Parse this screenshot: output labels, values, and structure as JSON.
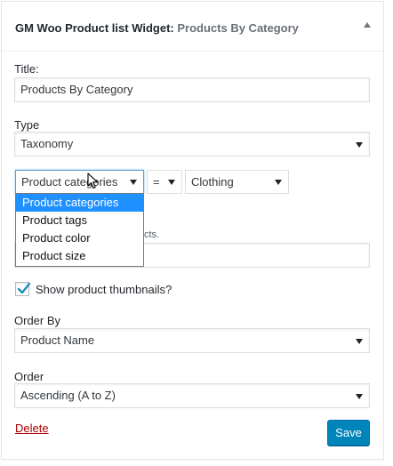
{
  "widget": {
    "title": "GM Woo Product list Widget:",
    "instance_title": "Products By Category"
  },
  "form": {
    "title_label": "Title:",
    "title_value": "Products By Category",
    "type_label": "Type",
    "type_value": "Taxonomy",
    "taxonomy_value": "Product categories",
    "operator_value": "=",
    "term_value": "Clothing",
    "taxonomy_options": [
      "Product categories",
      "Product tags",
      "Product color",
      "Product size"
    ],
    "selected_option_index": 0,
    "hint_fragment": "cts.",
    "thumbnails_label": "Show product thumbnails?",
    "thumbnails_checked": true,
    "orderby_label": "Order By",
    "orderby_value": "Product Name",
    "order_label": "Order",
    "order_value": "Ascending (A to Z)"
  },
  "actions": {
    "delete_label": "Delete",
    "save_label": "Save"
  },
  "colors": {
    "accent": "#0085ba",
    "delete": "#aa0000",
    "dropdown_highlight": "#1e90ff"
  }
}
